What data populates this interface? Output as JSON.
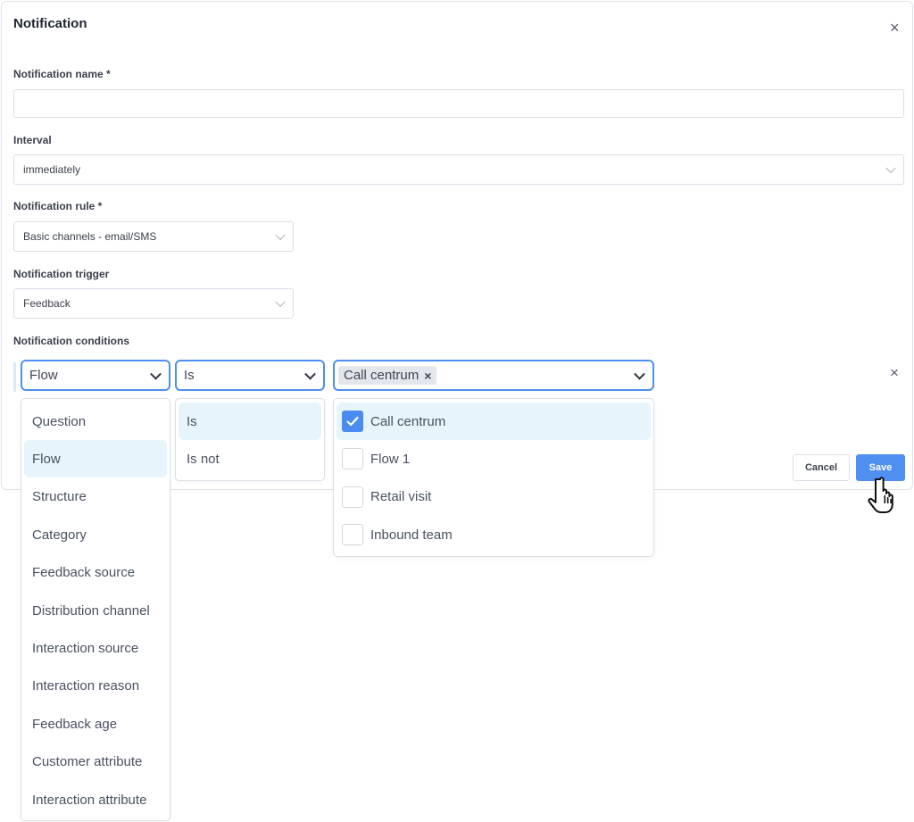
{
  "dialog": {
    "title": "Notification",
    "close_icon": "close-icon"
  },
  "form": {
    "name": {
      "label": "Notification name *",
      "value": "",
      "placeholder": ""
    },
    "interval": {
      "label": "Interval",
      "value": "immediately"
    },
    "rule": {
      "label": "Notification rule *",
      "value": "Basic channels - email/SMS"
    },
    "trigger": {
      "label": "Notification trigger",
      "value": "Feedback"
    },
    "conditions": {
      "label": "Notification conditions",
      "field_select": "Flow",
      "operator_select": "Is",
      "value_chip": "Call centrum",
      "chip_remove": "×",
      "remove_condition": "×"
    }
  },
  "field_options": [
    "Question",
    "Flow",
    "Structure",
    "Category",
    "Feedback source",
    "Distribution channel",
    "Interaction source",
    "Interaction reason",
    "Feedback age",
    "Customer attribute",
    "Interaction attribute"
  ],
  "field_selected": "Flow",
  "operator_options": [
    "Is",
    "Is not"
  ],
  "operator_selected": "Is",
  "value_options": [
    {
      "label": "Call centrum",
      "checked": true
    },
    {
      "label": "Flow 1",
      "checked": false
    },
    {
      "label": "Retail visit",
      "checked": false
    },
    {
      "label": "Inbound team",
      "checked": false
    }
  ],
  "buttons": {
    "cancel": "Cancel",
    "save": "Save"
  },
  "colors": {
    "accent": "#4f8ff0",
    "selected_bg": "#e6f4fb",
    "border": "#dadee5"
  }
}
